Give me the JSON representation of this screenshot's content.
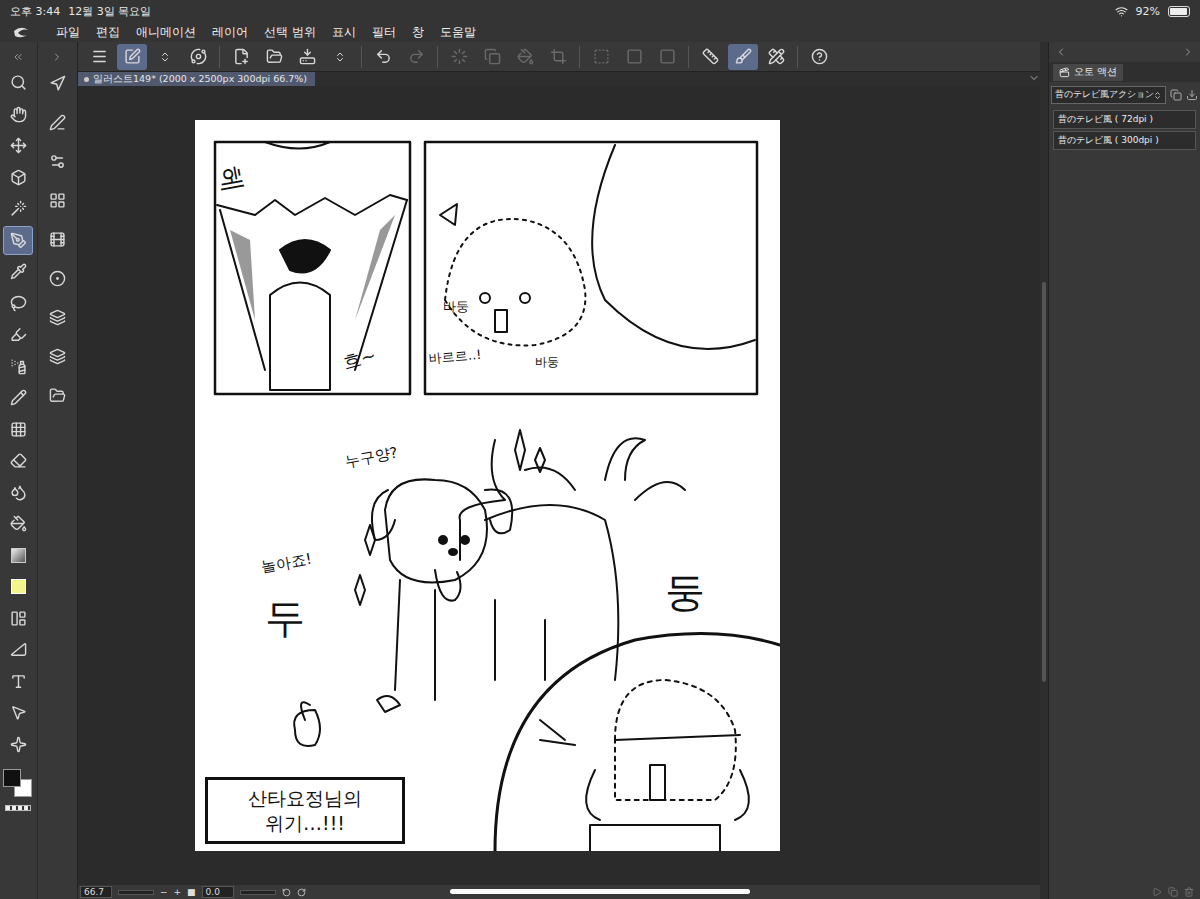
{
  "status_bar": {
    "time": "오후 3:44",
    "date": "12월 3일 목요일",
    "battery": "92%",
    "battery_level": 0.92
  },
  "menu": [
    "파일",
    "편집",
    "애니메이션",
    "레이어",
    "선택 범위",
    "표시",
    "필터",
    "창",
    "도움말"
  ],
  "command_bar": [
    {
      "selected": false
    },
    {
      "selected": true
    },
    {
      "selected": false
    },
    {
      "selected": false
    },
    {
      "selected": false
    },
    {
      "selected": false
    },
    {
      "selected": false
    },
    {
      "selected": false
    },
    {
      "selected": false
    },
    {
      "selected": false
    },
    {
      "selected": false
    },
    {
      "selected": false
    },
    {
      "selected": false
    },
    {
      "selected": false
    },
    {
      "selected": false
    },
    {
      "selected": false
    },
    {
      "selected": false
    },
    {
      "selected": false
    },
    {
      "selected": true
    },
    {
      "selected": false
    },
    {
      "selected": false
    }
  ],
  "tools": [
    {
      "selected": false
    },
    {
      "selected": false
    },
    {
      "selected": false
    },
    {
      "selected": false
    },
    {
      "selected": false
    },
    {
      "selected": true
    },
    {
      "selected": false
    },
    {
      "selected": false
    },
    {
      "selected": false
    },
    {
      "selected": false
    },
    {
      "selected": false
    },
    {
      "selected": false
    },
    {
      "selected": false
    },
    {
      "selected": false
    },
    {
      "selected": false
    },
    {
      "selected": false
    },
    {
      "selected": false
    },
    {
      "selected": false
    },
    {
      "selected": false
    },
    {
      "selected": false
    },
    {
      "selected": false
    },
    {
      "selected": false
    }
  ],
  "sub_tools": [
    {
      "selected": false
    },
    {
      "selected": false
    },
    {
      "selected": false
    },
    {
      "selected": false
    },
    {
      "selected": false
    },
    {
      "selected": false
    },
    {
      "selected": false
    },
    {
      "selected": false
    },
    {
      "selected": false
    }
  ],
  "colors": {
    "main": "#111111",
    "sub": "#ffffff"
  },
  "document_tab": {
    "title": "일러스트149* (2000 x 2500px 300dpi 66.7%)"
  },
  "canvas": {
    "texts": [
      "헤",
      "흐~",
      "바둥",
      "바르르..!",
      "바둥",
      "누구양?",
      "놀아죠!",
      "두",
      "둥"
    ],
    "caption": "산타요정님의 위기…!!!"
  },
  "auto_action": {
    "title": "오토 액션",
    "set": "昔のテレビ風アクション",
    "items": [
      {
        "label": "昔のテレビ風 ( 72dpi )",
        "selected": false
      },
      {
        "label": "昔のテレビ風 ( 300dpi )",
        "selected": false
      }
    ]
  },
  "bottom_bar": {
    "zoom": "66.7",
    "angle": "0.0"
  }
}
